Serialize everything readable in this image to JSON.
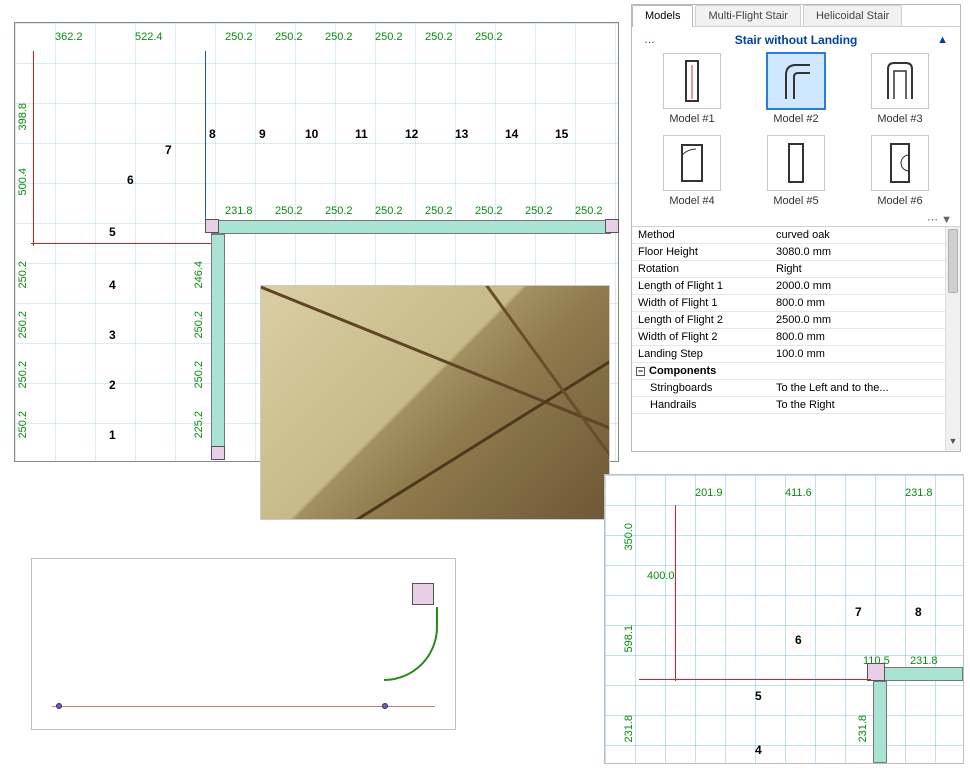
{
  "tabs": {
    "models": "Models",
    "multi": "Multi-Flight Stair",
    "helic": "Helicoidal Stair"
  },
  "section_title": "Stair without Landing",
  "models": [
    {
      "label": "Model #1"
    },
    {
      "label": "Model #2"
    },
    {
      "label": "Model #3"
    },
    {
      "label": "Model #4"
    },
    {
      "label": "Model #5"
    },
    {
      "label": "Model #6"
    }
  ],
  "selected_model_index": 1,
  "properties": {
    "method": {
      "k": "Method",
      "v": "curved oak"
    },
    "floor_height": {
      "k": "Floor Height",
      "v": "3080.0 mm"
    },
    "rotation": {
      "k": "Rotation",
      "v": "Right"
    },
    "len_f1": {
      "k": "Length of Flight 1",
      "v": "2000.0 mm"
    },
    "wid_f1": {
      "k": "Width of Flight 1",
      "v": "800.0 mm"
    },
    "len_f2": {
      "k": "Length of Flight 2",
      "v": "2500.0 mm"
    },
    "wid_f2": {
      "k": "Width of Flight 2",
      "v": "800.0 mm"
    },
    "landing": {
      "k": "Landing Step",
      "v": "100.0 mm"
    },
    "components_header": "Components",
    "stringboards": {
      "k": "Stringboards",
      "v": "To the Left and to the..."
    },
    "handrails": {
      "k": "Handrails",
      "v": "To the Right"
    }
  },
  "plan_top": {
    "dims_horizontal": [
      "362.2",
      "522.4",
      "250.2",
      "250.2",
      "250.2",
      "250.2",
      "250.2",
      "250.2"
    ],
    "dims_vertical_left": [
      "398.8",
      "500.4",
      "250.2",
      "250.2",
      "250.2",
      "250.2"
    ],
    "dims_mid": [
      "231.8",
      "250.2",
      "250.2",
      "250.2",
      "250.2",
      "250.2",
      "250.2",
      "250.2"
    ],
    "dims_col": [
      "246.4",
      "250.2",
      "250.2",
      "225.2"
    ],
    "step_numbers_top": [
      "8",
      "9",
      "10",
      "11",
      "12",
      "13",
      "14",
      "15"
    ],
    "step_numbers_diag": [
      "7",
      "6",
      "5",
      "4",
      "3",
      "2",
      "1"
    ]
  },
  "plan_zoom": {
    "dims_top": [
      "201.9",
      "411.6",
      "231.8"
    ],
    "dims_left": [
      "350.0",
      "400.0",
      "598.1",
      "231.8"
    ],
    "dims_right": [
      "110.5",
      "231.8",
      "231.8"
    ],
    "step_numbers": [
      "8",
      "7",
      "6",
      "5",
      "4"
    ]
  }
}
